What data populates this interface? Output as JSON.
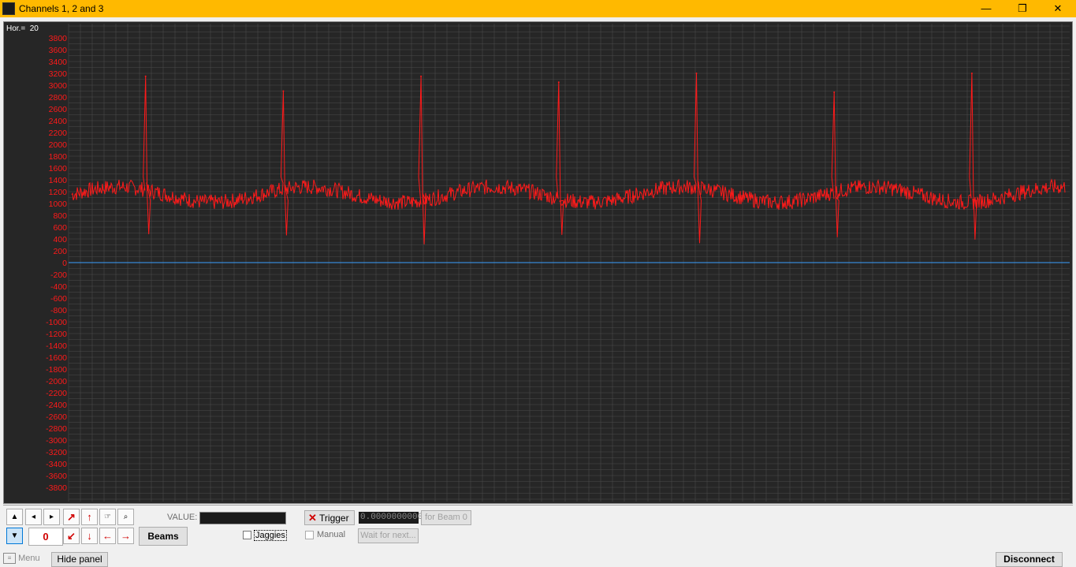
{
  "window": {
    "title": "Channels 1, 2 and 3",
    "controls": {
      "minimize": "—",
      "maximize": "❐",
      "close": "✕"
    }
  },
  "plot": {
    "hor_label": "Hor.=",
    "hor_value": "20",
    "colors": {
      "signal": "#ff1a1a",
      "baseline": "#3aa0ff",
      "grid": "#4a4a4a",
      "tick_text": "#ff1a1a",
      "background": "#262626"
    }
  },
  "chart_data": {
    "type": "line",
    "ylim": [
      -3900,
      4000
    ],
    "yticks": [
      3800,
      3600,
      3400,
      3200,
      3000,
      2800,
      2600,
      2400,
      2200,
      2000,
      1800,
      1600,
      1400,
      1200,
      1000,
      800,
      600,
      400,
      200,
      0,
      -200,
      -400,
      -600,
      -800,
      -1000,
      -1200,
      -1400,
      -1600,
      -1800,
      -2000,
      -2200,
      -2400,
      -2600,
      -2800,
      -3000,
      -3200,
      -3400,
      -3600,
      -3800
    ],
    "ytick_labels": [
      "3800",
      "3600",
      "3400",
      "3200",
      "3000",
      "2800",
      "2600",
      "2400",
      "2200",
      "2000",
      "1800",
      "1600",
      "1400",
      "1200",
      "1000",
      "800",
      "600",
      "400",
      "200",
      "0",
      "-200",
      "-400",
      "-600",
      "-800",
      "-1000",
      "-1200",
      "-1400",
      "-1600",
      "-1800",
      "-2000",
      "-2200",
      "-2400",
      "-2600",
      "-2800",
      "-3000",
      "-3200",
      "-3400",
      "-3600",
      "-3800"
    ],
    "grid": true,
    "series": [
      {
        "color": "#ff1a1a",
        "baseline_level": 1150,
        "peaks": [
          {
            "x": 0.074,
            "max": 3150,
            "min": 480
          },
          {
            "x": 0.212,
            "max": 2900,
            "min": 460
          },
          {
            "x": 0.35,
            "max": 3150,
            "min": 310
          },
          {
            "x": 0.488,
            "max": 3050,
            "min": 470
          },
          {
            "x": 0.626,
            "max": 3200,
            "min": 330
          },
          {
            "x": 0.764,
            "max": 2880,
            "min": 430
          },
          {
            "x": 0.902,
            "max": 3200,
            "min": 390
          }
        ]
      },
      {
        "color": "#3aa0ff",
        "constant": 0
      }
    ]
  },
  "panel": {
    "zero_value": "0",
    "value_label": "VALUE:",
    "beams_button": "Beams",
    "jaggies_label": "Jaggies",
    "trigger_button": "Trigger",
    "trigger_value": "0.0000000000",
    "for_beam_button": "for Beam 0",
    "manual_label": "Manual",
    "wait_button": "Wait for next..."
  },
  "bottom": {
    "menu_label": "Menu",
    "hide_panel_button": "Hide panel",
    "disconnect_button": "Disconnect"
  }
}
